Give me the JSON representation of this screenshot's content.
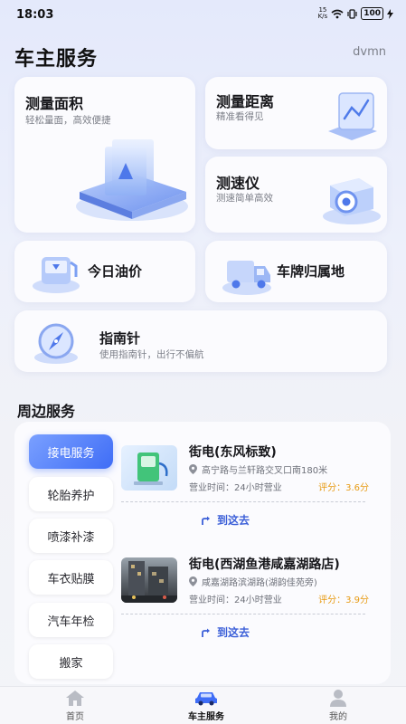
{
  "status_bar": {
    "time": "18:03",
    "net_speed_top": "15",
    "net_speed_bottom": "K/s",
    "battery": "100"
  },
  "header": {
    "title": "车主服务",
    "user": "dvmn"
  },
  "tools": {
    "area": {
      "title": "测量面积",
      "subtitle": "轻松量面，高效便捷"
    },
    "distance": {
      "title": "测量距离",
      "subtitle": "精准看得见"
    },
    "speed": {
      "title": "测速仪",
      "subtitle": "测速简单高效"
    },
    "oil": {
      "title": "今日油价"
    },
    "plate": {
      "title": "车牌归属地"
    },
    "compass": {
      "title": "指南针",
      "subtitle": "使用指南针，出行不偏航"
    }
  },
  "nearby": {
    "title": "周边服务",
    "categories": [
      "接电服务",
      "轮胎养护",
      "喷漆补漆",
      "车衣贴膜",
      "汽车年检",
      "搬家"
    ],
    "active_category": "接电服务",
    "stations": [
      {
        "name": "街电(东风标致)",
        "address": "高宁路与兰轩路交叉口南180米",
        "hours": "营业时间：24小时营业",
        "rating_label": "评分：",
        "rating": "3.6分",
        "action": "到这去"
      },
      {
        "name": "街电(西湖鱼港咸嘉湖路店)",
        "address": "咸嘉湖路滨湖路(湖韵佳苑旁)",
        "hours": "营业时间：24小时营业",
        "rating_label": "评分：",
        "rating": "3.9分",
        "action": "到这去"
      }
    ]
  },
  "tab_bar": {
    "tabs": [
      "首页",
      "车主服务",
      "我的"
    ],
    "active": "车主服务"
  },
  "colors": {
    "accent": "#3f6df6",
    "rating": "#e79b14",
    "link": "#3b5fd8"
  }
}
